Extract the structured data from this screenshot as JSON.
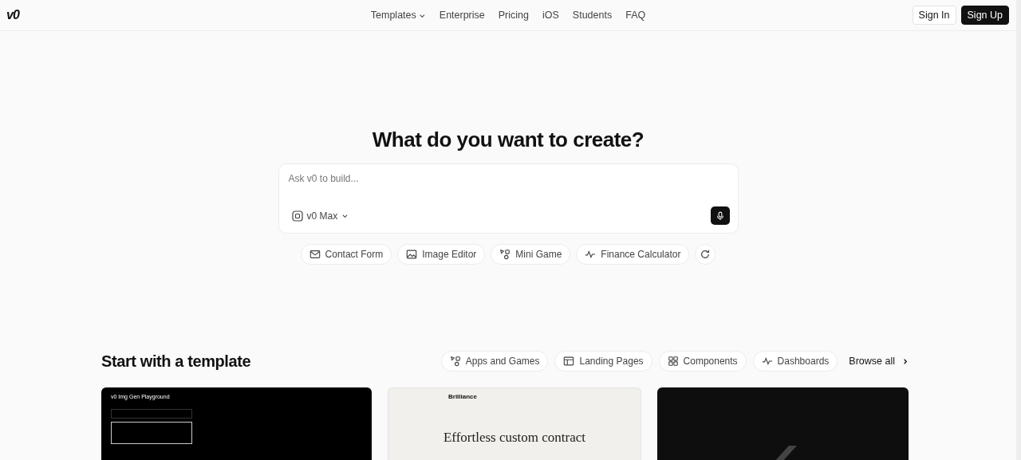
{
  "header": {
    "logo": "v0",
    "nav": [
      {
        "label": "Templates",
        "dropdown": true
      },
      {
        "label": "Enterprise",
        "dropdown": false
      },
      {
        "label": "Pricing",
        "dropdown": false
      },
      {
        "label": "iOS",
        "dropdown": false
      },
      {
        "label": "Students",
        "dropdown": false
      },
      {
        "label": "FAQ",
        "dropdown": false
      }
    ],
    "sign_in": "Sign In",
    "sign_up": "Sign Up"
  },
  "hero": {
    "title": "What do you want to create?",
    "prompt": {
      "placeholder": "Ask v0 to build...",
      "model": "v0 Max"
    },
    "suggestions": [
      {
        "label": "Contact Form",
        "kind": "mail"
      },
      {
        "label": "Image Editor",
        "kind": "image"
      },
      {
        "label": "Mini Game",
        "kind": "shapes"
      },
      {
        "label": "Finance Calculator",
        "kind": "pulse"
      }
    ]
  },
  "templates": {
    "title": "Start with a template",
    "categories": [
      {
        "label": "Apps and Games",
        "kind": "shapes"
      },
      {
        "label": "Landing Pages",
        "kind": "layout"
      },
      {
        "label": "Components",
        "kind": "grid"
      },
      {
        "label": "Dashboards",
        "kind": "pulse"
      }
    ],
    "browse_all": "Browse all",
    "cards": [
      {
        "kind": "dark-app",
        "title": "v0 Img Gen Playground"
      },
      {
        "kind": "light-landing",
        "brand": "Brilliance",
        "heading": "Effortless custom contract"
      },
      {
        "kind": "dark-logo"
      }
    ]
  }
}
